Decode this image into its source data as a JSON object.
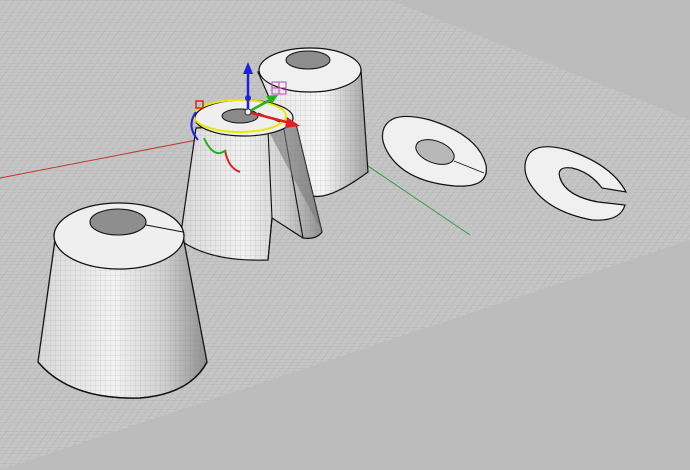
{
  "viewport": {
    "view": "perspective",
    "background_color": "#bcbcbc",
    "grid_color": "#9a9a9a",
    "grid_plane_color": "#c4c4c4",
    "axis_x_color": "#c0392b",
    "axis_y_color": "#2e9e44",
    "objects": [
      {
        "name": "tapered-ring-solid"
      },
      {
        "name": "split-tapered-ring-solid"
      },
      {
        "name": "tapered-ring-solid-back"
      },
      {
        "name": "flat-annulus-surface"
      },
      {
        "name": "split-annulus-surface"
      }
    ],
    "gumball": {
      "visible": true,
      "x_arrow_color": "#e02020",
      "y_arrow_color": "#22b022",
      "z_arrow_color": "#2020e0",
      "rotate_ring_color": "#e8e800"
    }
  }
}
